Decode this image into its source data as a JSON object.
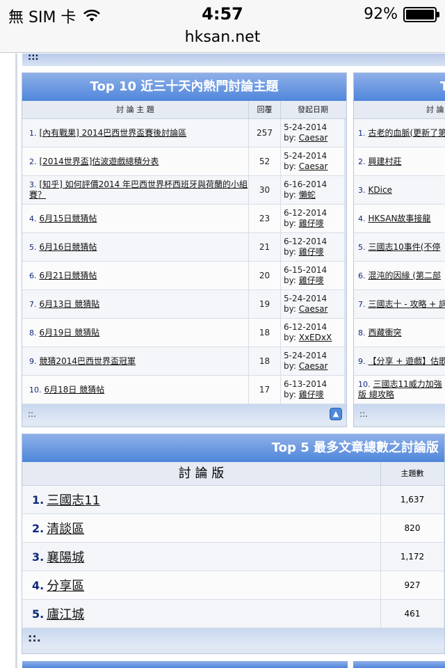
{
  "status_bar": {
    "carrier": "無 SIM 卡",
    "time": "4:57",
    "battery_percent": "92%",
    "wifi_icon": "wifi-icon",
    "battery_level": 0.92
  },
  "address_bar": {
    "url": "hksan.net"
  },
  "top_strip": {
    "label": ":::"
  },
  "hot_topics": {
    "title": "Top 10 近三十天內熱門討論主題",
    "columns": {
      "topic": "討 論 主 題",
      "replies": "回覆",
      "date": "發起日期"
    },
    "rows": [
      {
        "num": "1.",
        "title": "[內有戰果] 2014巴西世界盃賽後討論區",
        "replies": "257",
        "date": "5-24-2014",
        "by": "by:",
        "author": "Caesar"
      },
      {
        "num": "2.",
        "title": "[2014世界盃]估波遊戲總積分表",
        "replies": "52",
        "date": "5-24-2014",
        "by": "by:",
        "author": "Caesar"
      },
      {
        "num": "3.",
        "title": "[知乎] 如何評價2014 年巴西世界杯西班牙與荷蘭的小組賽？",
        "replies": "30",
        "date": "6-16-2014",
        "by": "by:",
        "author": "懶蛇"
      },
      {
        "num": "4.",
        "title": "6月15日競猜帖",
        "replies": "23",
        "date": "6-12-2014",
        "by": "by:",
        "author": "雞仔嘜"
      },
      {
        "num": "5.",
        "title": "6月16日競猜帖",
        "replies": "21",
        "date": "6-12-2014",
        "by": "by:",
        "author": "雞仔嘜"
      },
      {
        "num": "6.",
        "title": "6月21日競猜帖",
        "replies": "20",
        "date": "6-15-2014",
        "by": "by:",
        "author": "雞仔嘜"
      },
      {
        "num": "7.",
        "title": "6月13日 競猜貼",
        "replies": "19",
        "date": "5-24-2014",
        "by": "by:",
        "author": "Caesar"
      },
      {
        "num": "8.",
        "title": "6月19日 競猜貼",
        "replies": "18",
        "date": "6-12-2014",
        "by": "by:",
        "author": "XxEDxX"
      },
      {
        "num": "9.",
        "title": "競猜2014巴西世界盃冠軍",
        "replies": "18",
        "date": "5-24-2014",
        "by": "by:",
        "author": "Caesar"
      },
      {
        "num": "10.",
        "title": "6月18日 競猜帖",
        "replies": "17",
        "date": "6-13-2014",
        "by": "by:",
        "author": "雞仔嘜"
      }
    ],
    "footer": "::.",
    "up_icon": "arrow-up-icon"
  },
  "right_panel": {
    "title": "T",
    "column_topic": "討 論",
    "rows": [
      {
        "num": "1.",
        "title": "古老的血脈(更新了第"
      },
      {
        "num": "2.",
        "title": "興建村莊"
      },
      {
        "num": "3.",
        "title": "KDice"
      },
      {
        "num": "4.",
        "title": "HKSAN故事接龍"
      },
      {
        "num": "5.",
        "title": "三國志10事件(不停"
      },
      {
        "num": "6.",
        "title": "混沌的因緣 (第二部"
      },
      {
        "num": "7.",
        "title": "三國志十 - 攻略 + 詞"
      },
      {
        "num": "8.",
        "title": "西藏衝突"
      },
      {
        "num": "9.",
        "title": "【分享 + 遊戲】估歌"
      },
      {
        "num": "10.",
        "title": "三國志11威力加強版 總攻略"
      }
    ],
    "footer": "::."
  },
  "top_forums": {
    "title": "Top 5 最多文章總數之討論版",
    "columns": {
      "forum": "討 論 版",
      "topics": "主題數"
    },
    "rows": [
      {
        "num": "1.",
        "name": "三國志11",
        "topics": "1,637"
      },
      {
        "num": "2.",
        "name": "清談區",
        "topics": "820"
      },
      {
        "num": "3.",
        "name": "襄陽城",
        "topics": "1,172"
      },
      {
        "num": "4.",
        "name": "分享區",
        "topics": "927"
      },
      {
        "num": "5.",
        "name": "廬江城",
        "topics": "461"
      }
    ],
    "footer": "::."
  }
}
